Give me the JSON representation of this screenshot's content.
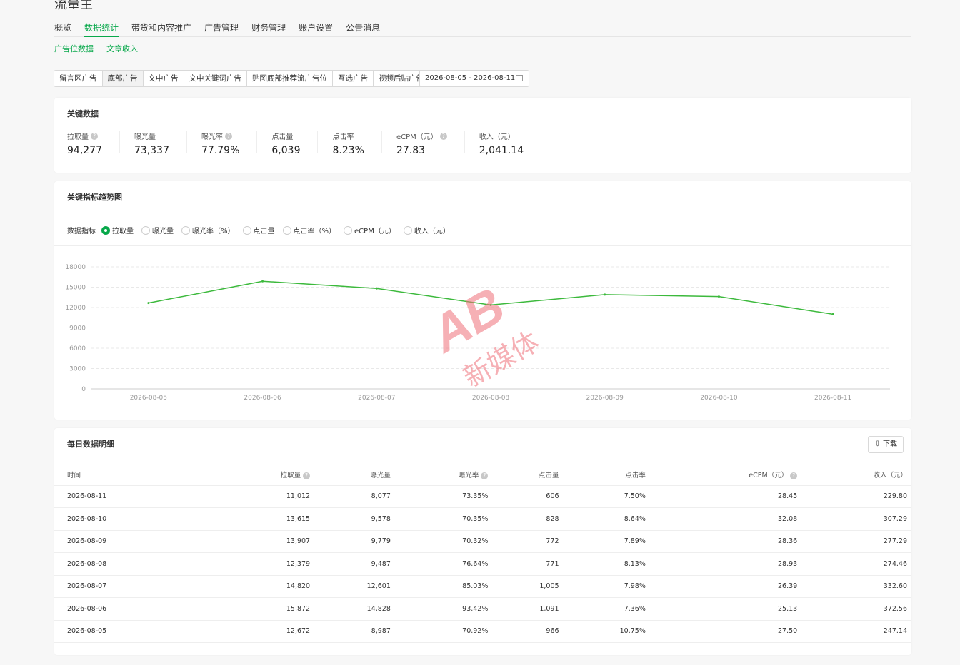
{
  "app_title": "流量主",
  "nav_tabs": [
    "概览",
    "数据统计",
    "带货和内容推广",
    "广告管理",
    "财务管理",
    "账户设置",
    "公告消息"
  ],
  "active_nav": "数据统计",
  "sub_tabs": [
    "广告位数据",
    "文章收入"
  ],
  "ad_tabs": [
    "留言区广告",
    "底部广告",
    "文中广告",
    "文中关键词广告",
    "贴图底部推荐流广告位",
    "互选广告",
    "视频后贴广告"
  ],
  "active_ad_tab": "底部广告",
  "date_range": "2026-08-05 - 2026-08-11",
  "key_data": {
    "title": "关键数据",
    "metrics": [
      {
        "label": "拉取量",
        "value": "94,277",
        "help": true
      },
      {
        "label": "曝光量",
        "value": "73,337",
        "help": false
      },
      {
        "label": "曝光率",
        "value": "77.79%",
        "help": true
      },
      {
        "label": "点击量",
        "value": "6,039",
        "help": false
      },
      {
        "label": "点击率",
        "value": "8.23%",
        "help": false
      },
      {
        "label": "eCPM（元）",
        "value": "27.83",
        "help": true
      },
      {
        "label": "收入（元）",
        "value": "2,041.14",
        "help": false
      }
    ]
  },
  "trend": {
    "title": "关键指标趋势图",
    "metric_label": "数据指标",
    "options": [
      "拉取量",
      "曝光量",
      "曝光率（%）",
      "点击量",
      "点击率（%）",
      "eCPM（元）",
      "收入（元）"
    ],
    "selected": "拉取量"
  },
  "chart_data": {
    "type": "line",
    "x": [
      "2026-08-05",
      "2026-08-06",
      "2026-08-07",
      "2026-08-08",
      "2026-08-09",
      "2026-08-10",
      "2026-08-11"
    ],
    "series": [
      {
        "values": [
          12672,
          15872,
          14820,
          12379,
          13907,
          13615,
          11012
        ]
      }
    ],
    "yticks": [
      "0",
      "3000",
      "6000",
      "9000",
      "12000",
      "15000",
      "18000"
    ],
    "ylim": [
      0,
      18000
    ],
    "grid": true,
    "color": "#3cb93c"
  },
  "daily": {
    "title": "每日数据明细",
    "download": "下载",
    "columns": [
      "时间",
      "拉取量",
      "曝光量",
      "曝光率",
      "点击量",
      "点击率",
      "eCPM（元）",
      "收入（元）"
    ],
    "column_help": [
      false,
      true,
      false,
      true,
      false,
      false,
      true,
      false
    ],
    "rows": [
      [
        "2026-08-11",
        "11,012",
        "8,077",
        "73.35%",
        "606",
        "7.50%",
        "28.45",
        "229.80"
      ],
      [
        "2026-08-10",
        "13,615",
        "9,578",
        "70.35%",
        "828",
        "8.64%",
        "32.08",
        "307.29"
      ],
      [
        "2026-08-09",
        "13,907",
        "9,779",
        "70.32%",
        "772",
        "7.89%",
        "28.36",
        "277.29"
      ],
      [
        "2026-08-08",
        "12,379",
        "9,487",
        "76.64%",
        "771",
        "8.13%",
        "28.93",
        "274.46"
      ],
      [
        "2026-08-07",
        "14,820",
        "12,601",
        "85.03%",
        "1,005",
        "7.98%",
        "26.39",
        "332.60"
      ],
      [
        "2026-08-06",
        "15,872",
        "14,828",
        "93.42%",
        "1,091",
        "7.36%",
        "25.13",
        "372.56"
      ],
      [
        "2026-08-05",
        "12,672",
        "8,987",
        "70.92%",
        "966",
        "10.75%",
        "27.50",
        "247.14"
      ]
    ]
  },
  "watermark": {
    "logo": "AB",
    "text": "新媒体"
  },
  "colors": {
    "accent": "#07a84a",
    "line": "#3cb93c",
    "watermark": "#f0707a"
  }
}
